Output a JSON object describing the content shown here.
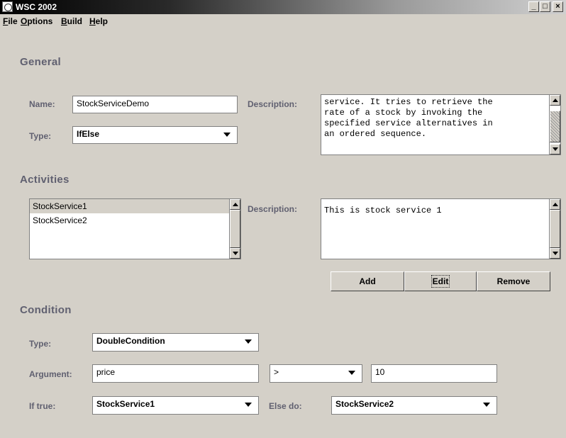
{
  "window": {
    "title": "WSC 2002"
  },
  "menu": [
    "File",
    "Options",
    "Build",
    "Help"
  ],
  "general": {
    "heading": "General",
    "name_label": "Name:",
    "name_value": "StockServiceDemo",
    "type_label": "Type:",
    "type_value": "IfElse",
    "desc_label": "Description:",
    "desc_lines": [
      "service. It tries to retrieve the",
      "rate of a stock by invoking the",
      "specified service alternatives in",
      "an ordered sequence."
    ]
  },
  "activities": {
    "heading": "Activities",
    "items": [
      "StockService1",
      "StockService2"
    ],
    "selected_index": 0,
    "desc_label": "Description:",
    "desc_text": "This is stock service 1",
    "buttons": {
      "add": "Add",
      "edit": "Edit",
      "remove": "Remove"
    }
  },
  "condition": {
    "heading": "Condition",
    "type_label": "Type:",
    "type_value": "DoubleCondition",
    "argument_label": "Argument:",
    "argument_value": "price",
    "operator_value": ">",
    "compare_value": "10",
    "if_true_label": "If true:",
    "if_true_value": "StockService1",
    "else_label": "Else do:",
    "else_value": "StockService2"
  },
  "icons": {
    "app": "java-cup-icon",
    "minimize": "minimize-icon",
    "maximize": "maximize-icon",
    "close": "close-icon"
  }
}
